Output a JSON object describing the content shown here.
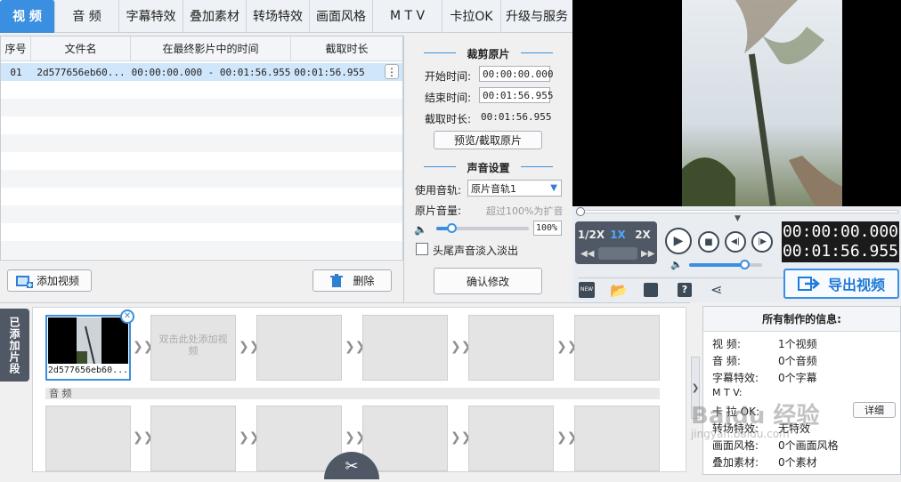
{
  "nav": {
    "tabs": [
      {
        "label": "视 频",
        "active": true
      },
      {
        "label": "音 频"
      },
      {
        "label": "字幕特效"
      },
      {
        "label": "叠加素材"
      },
      {
        "label": "转场特效"
      },
      {
        "label": "画面风格"
      },
      {
        "label": "M T V"
      },
      {
        "label": "卡拉OK"
      },
      {
        "label": "升级与服务"
      }
    ]
  },
  "table": {
    "headers": [
      "序号",
      "文件名",
      "在最终影片中的时间",
      "截取时长"
    ],
    "rows": [
      {
        "index": "01",
        "filename": "2d577656eb60...",
        "time_range": "00:00:00.000 - 00:01:56.955",
        "duration": "00:01:56.955"
      }
    ],
    "more_icon": "⋮"
  },
  "buttons": {
    "add_video": "添加视频",
    "delete": "删除",
    "preview_cut": "预览/截取原片",
    "confirm": "确认修改",
    "export": "导出视频",
    "detail": "详细"
  },
  "edit": {
    "cut_title": "裁剪原片",
    "start_label": "开始时间:",
    "start_value": "00:00:00.000",
    "end_label": "结束时间:",
    "end_value": "00:01:56.955",
    "duration_label": "截取时长:",
    "duration_value": "00:01:56.955",
    "sound_title": "声音设置",
    "track_label": "使用音轨:",
    "track_value": "原片音轨1",
    "volume_label": "原片音量:",
    "volume_hint": "超过100%为扩音",
    "volume_value": "100%",
    "fade_label": "头尾声音淡入淡出"
  },
  "player": {
    "speeds": [
      "1/2X",
      "1X",
      "2X"
    ],
    "active_speed": "1X",
    "time_current": "00:00:00.000",
    "time_total": "00:01:56.955",
    "progress": 0.0,
    "volume_level": 0.75
  },
  "timeline": {
    "side_label": "已添加片段",
    "first_clip_name": "2d577656eb60...",
    "add_clip_hint": "双击此处添加视频",
    "audio_label": "音 频"
  },
  "info": {
    "title": "所有制作的信息:",
    "rows": [
      {
        "key": "视    频:",
        "value": "1个视频"
      },
      {
        "key": "音    频:",
        "value": "0个音频"
      },
      {
        "key": "字幕特效:",
        "value": "0个字幕"
      },
      {
        "key": "M  T  V:",
        "value": ""
      },
      {
        "key": "卡 拉 OK:",
        "value": ""
      },
      {
        "key": "转场特效:",
        "value": "无特效"
      },
      {
        "key": "画面风格:",
        "value": "0个画面风格"
      },
      {
        "key": "叠加素材:",
        "value": "0个素材"
      }
    ]
  },
  "watermark": {
    "text": "Baidu 经验",
    "sub": "jingyan.baidu.com"
  },
  "colors": {
    "accent": "#3a8fe0",
    "selected_row": "#cfe6fb",
    "export_text": "#1f7ad8"
  }
}
